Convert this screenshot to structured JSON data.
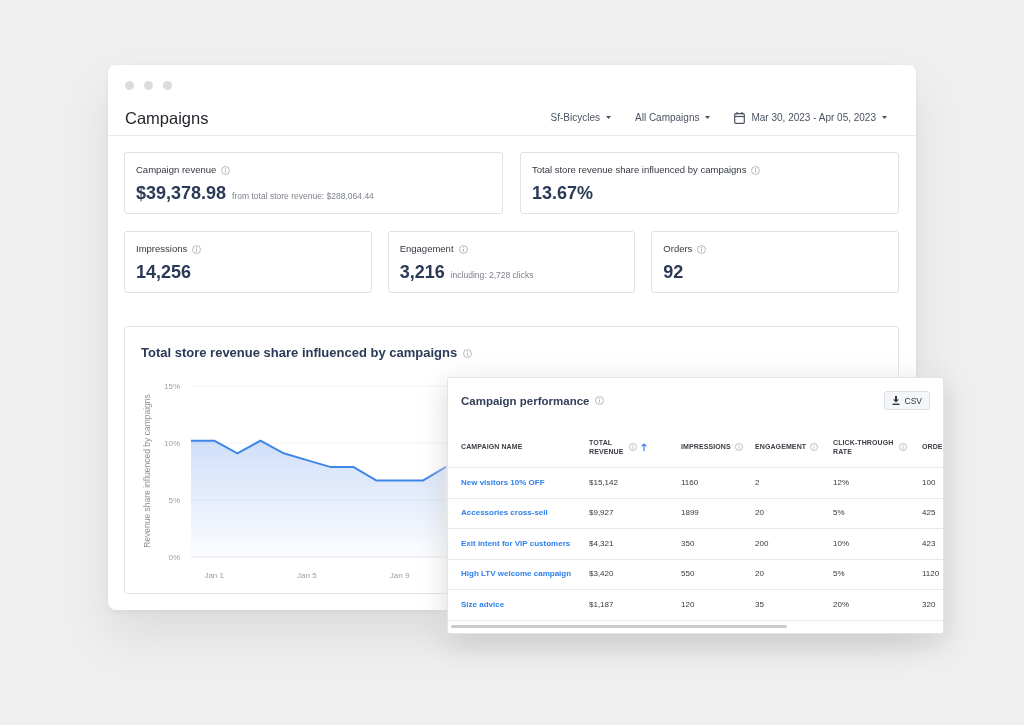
{
  "window": {
    "title": "Campaigns"
  },
  "filters": [
    {
      "kind": "select",
      "label": "Sf-Bicycles"
    },
    {
      "kind": "select",
      "label": "All Campaigns"
    },
    {
      "kind": "date_range",
      "label": "Mar 30, 2023 - Apr 05, 2023"
    }
  ],
  "summary_cards": [
    {
      "label": "Campaign revenue",
      "value": "$39,378.98",
      "note": "from total store revenue: $288,064.44"
    },
    {
      "label": "Total store revenue share influenced by campaigns",
      "value": "13.67%"
    }
  ],
  "metric_cards": [
    {
      "label": "Impressions",
      "value": "14,256"
    },
    {
      "label": "Engagement",
      "value": "3,216",
      "note": "including: 2,728 clicks"
    },
    {
      "label": "Orders",
      "value": "92"
    }
  ],
  "revenue_share_chart": {
    "title": "Total store revenue share influenced by campaigns",
    "chart_data": {
      "type": "area",
      "ylabel": "Revenue share influenced by campaigns",
      "categories": [
        null,
        "Jan 1",
        null,
        null,
        null,
        "Jan 5",
        null,
        null,
        null,
        "Jan 9",
        null,
        null
      ],
      "values": [
        10.2,
        10.2,
        9.1,
        10.2,
        9.1,
        8.5,
        7.9,
        7.9,
        6.7,
        6.7,
        6.7,
        7.9
      ],
      "ylim": [
        0,
        15
      ],
      "yticks": [
        {
          "value": 0,
          "label": "0%"
        },
        {
          "value": 5,
          "label": "5%"
        },
        {
          "value": 10,
          "label": "10%"
        },
        {
          "value": 15,
          "label": "15%"
        }
      ]
    }
  },
  "performance_table": {
    "title": "Campaign performance",
    "export_button": "CSV",
    "columns": [
      {
        "label": "CAMPAIGN NAME",
        "info": false,
        "sorted": false
      },
      {
        "label": "TOTAL REVENUE",
        "info": true,
        "sorted": true
      },
      {
        "label": "IMPRESSIONS",
        "info": true,
        "sorted": false
      },
      {
        "label": "ENGAGEMENT",
        "info": true,
        "sorted": false
      },
      {
        "label": "CLICK-THROUGH RATE",
        "info": true,
        "sorted": false
      },
      {
        "label": "ORDE",
        "info": false,
        "sorted": false
      }
    ],
    "rows": [
      {
        "cells": [
          "New visitors 10% OFF",
          "$15,142",
          "1160",
          "2",
          "12%",
          "100"
        ]
      },
      {
        "cells": [
          "Accessories cross-sell",
          "$9,927",
          "1899",
          "20",
          "5%",
          "425"
        ]
      },
      {
        "cells": [
          "Exit intent for VIP customers",
          "$4,321",
          "350",
          "200",
          "10%",
          "423"
        ]
      },
      {
        "cells": [
          "High LTV welcome campaign",
          "$3,420",
          "550",
          "20",
          "5%",
          "1120"
        ]
      },
      {
        "cells": [
          "Size advice",
          "$1,187",
          "120",
          "35",
          "20%",
          "320"
        ]
      }
    ]
  }
}
